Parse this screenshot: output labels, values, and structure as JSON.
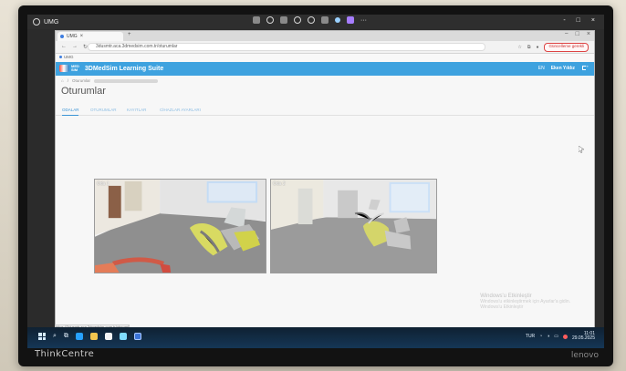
{
  "topbar": {
    "app_name": "UMG",
    "center_icons": [
      "video-camera-icon",
      "settings-icon",
      "trash-icon",
      "sparkle-icon",
      "record-icon",
      "chat-icon",
      "folder-icon",
      "app-icon",
      "more-icon"
    ],
    "right_controls": [
      "-",
      "□",
      "×"
    ]
  },
  "browser": {
    "tab_title": "UMG",
    "url": "3dusmtr.aca.3dmedsim.com.tr/oturumlar",
    "warning_label": "Güncelleme gerekli",
    "bookmark": "UMG",
    "window_controls": [
      "−",
      "□",
      "×"
    ]
  },
  "app": {
    "title": "3DMedSim Learning Suite",
    "lang": "EN",
    "exit_label": "Eken Yıldız",
    "breadcrumb_home": "⌂",
    "breadcrumb_text": "Oturumlar",
    "page_title": "Oturumlar",
    "tabs": [
      {
        "label": "ODALAR",
        "active": true
      },
      {
        "label": "OTURUMLAR",
        "active": false
      },
      {
        "label": "KAYITLAR",
        "active": false
      },
      {
        "label": "CİHAZLAR AYARLARI",
        "active": false
      }
    ],
    "rooms": [
      {
        "label": "Oda 1"
      },
      {
        "label": "Oda 2"
      }
    ]
  },
  "status": {
    "link_preview": "https://3dusmtr.aca.3dmedsim.com.tr/oturumlar"
  },
  "taskbar": {
    "time": "11:01",
    "date": "29.05.2025",
    "lang": "TUR",
    "watermark_title": "Windows'u Etkinleştir",
    "watermark_line1": "Windows'u etkinleştirmek için Ayarlar'a gidin.",
    "watermark_line2": "Windows'u Etkinleştir"
  },
  "device": {
    "brand": "ThinkCentre",
    "maker": "lenovo"
  },
  "colors": {
    "app_header": "#3ea2df",
    "active_tab": "#3c95d6",
    "warning": "#cc3333"
  }
}
